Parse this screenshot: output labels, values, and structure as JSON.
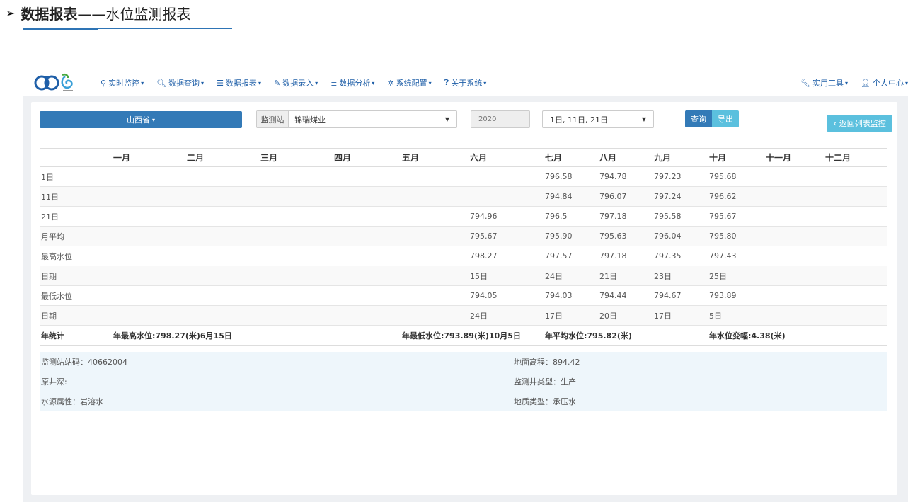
{
  "heading": {
    "arrow": "➢",
    "strong": "数据报表",
    "rest": "——水位监测报表"
  },
  "navbar": {
    "menu": [
      {
        "icon": "map-marker-icon",
        "glyph": "⚲",
        "label": "实时监控"
      },
      {
        "icon": "search-icon",
        "glyph": "🔍︎",
        "label": "数据查询"
      },
      {
        "icon": "list-icon",
        "glyph": "☰",
        "label": "数据报表"
      },
      {
        "icon": "edit-icon",
        "glyph": "✎",
        "label": "数据录入"
      },
      {
        "icon": "tasks-icon",
        "glyph": "≣",
        "label": "数据分析"
      },
      {
        "icon": "cog-icon",
        "glyph": "✲",
        "label": "系统配置"
      },
      {
        "icon": "question-circle-icon",
        "glyph": "❓︎",
        "label": "关于系统"
      }
    ],
    "right": [
      {
        "icon": "wrench-icon",
        "glyph": "🔧︎",
        "label": "实用工具"
      },
      {
        "icon": "user-icon",
        "glyph": "👤︎",
        "label": "个人中心"
      }
    ],
    "caret": "▾"
  },
  "filters": {
    "province": "山西省",
    "station_label": "监测站",
    "station_value": "锦瑞煤业",
    "year": "2020",
    "days": "1日, 11日, 21日",
    "query": "查询",
    "export": "导出",
    "back": "返回列表监控",
    "back_icon": "‹"
  },
  "table": {
    "months": [
      "一月",
      "二月",
      "三月",
      "四月",
      "五月",
      "六月",
      "七月",
      "八月",
      "九月",
      "十月",
      "十一月",
      "十二月"
    ],
    "rows": [
      {
        "label": "1日",
        "values": [
          "",
          "",
          "",
          "",
          "",
          "",
          "796.58",
          "794.78",
          "797.23",
          "795.68",
          "",
          ""
        ]
      },
      {
        "label": "11日",
        "values": [
          "",
          "",
          "",
          "",
          "",
          "",
          "794.84",
          "796.07",
          "797.24",
          "796.62",
          "",
          ""
        ]
      },
      {
        "label": "21日",
        "values": [
          "",
          "",
          "",
          "",
          "",
          "794.96",
          "796.5",
          "797.18",
          "795.58",
          "795.67",
          "",
          ""
        ]
      },
      {
        "label": "月平均",
        "values": [
          "",
          "",
          "",
          "",
          "",
          "795.67",
          "795.90",
          "795.63",
          "796.04",
          "795.80",
          "",
          ""
        ]
      },
      {
        "label": "最高水位",
        "values": [
          "",
          "",
          "",
          "",
          "",
          "798.27",
          "797.57",
          "797.18",
          "797.35",
          "797.43",
          "",
          ""
        ]
      },
      {
        "label": "日期",
        "values": [
          "",
          "",
          "",
          "",
          "",
          "15日",
          "24日",
          "21日",
          "23日",
          "25日",
          "",
          ""
        ]
      },
      {
        "label": "最低水位",
        "values": [
          "",
          "",
          "",
          "",
          "",
          "794.05",
          "794.03",
          "794.44",
          "794.67",
          "793.89",
          "",
          ""
        ]
      },
      {
        "label": "日期",
        "values": [
          "",
          "",
          "",
          "",
          "",
          "24日",
          "17日",
          "20日",
          "17日",
          "5日",
          "",
          ""
        ]
      }
    ],
    "summary": {
      "label": "年统计",
      "max": "年最高水位:798.27(米)6月15日",
      "min": "年最低水位:793.89(米)10月5日",
      "avg": "年平均水位:795.82(米)",
      "change": "年水位变幅:4.38(米)"
    }
  },
  "info": {
    "station_code": "监测站站码：40662004",
    "ground_elevation": "地面高程：894.42",
    "well_depth": "原井深:",
    "well_type": "监测井类型：生产",
    "water_source": "水源属性：岩溶水",
    "geology": "地质类型：承压水"
  }
}
